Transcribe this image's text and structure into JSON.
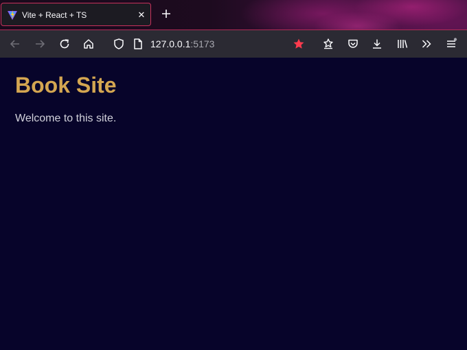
{
  "browser": {
    "tab": {
      "title": "Vite + React + TS",
      "favicon": "vite-logo",
      "close_icon": "close-icon",
      "active_border_color": "#c9305c"
    },
    "new_tab_icon": "plus-icon",
    "address": {
      "host": "127.0.0.1",
      "port": ":5173"
    },
    "toolbar_icons": {
      "back": "back-arrow-icon",
      "forward": "forward-arrow-icon",
      "reload": "reload-icon",
      "home": "home-icon",
      "shield": "shield-icon",
      "page": "page-icon",
      "bookmark": "star-icon",
      "extensions": "extension-icon",
      "pocket": "pocket-icon",
      "downloads": "download-icon",
      "library": "library-icon",
      "overflow": "chevrons-right-icon",
      "menu": "hamburger-menu-icon"
    },
    "bookmark_star_color": "#ff3b4e"
  },
  "page": {
    "title": "Book Site",
    "welcome": "Welcome to this site.",
    "title_color": "#d4a651",
    "background_color": "#07042a"
  }
}
